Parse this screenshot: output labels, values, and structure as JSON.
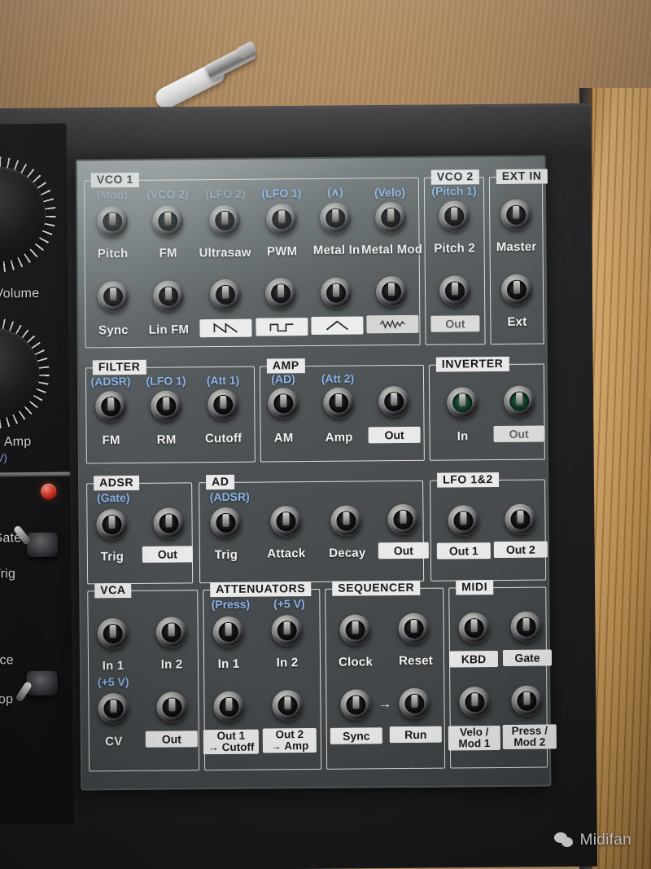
{
  "device": {
    "watermark_text": "Midifan",
    "watermark_icon": "wechat-icon"
  },
  "left_strip": {
    "controls": [
      {
        "label": "Volume",
        "type": "knob"
      },
      {
        "label": "- Amp",
        "sub": "V)",
        "type": "knob"
      },
      {
        "label": "Gate",
        "type": "toggle-top"
      },
      {
        "label": "Trig",
        "type": "toggle-bottom"
      },
      {
        "label": "nce",
        "type": "toggle-top"
      },
      {
        "label": "oop",
        "type": "toggle-bottom"
      }
    ]
  },
  "modules": [
    {
      "id": "vco1",
      "title": "VCO 1",
      "jacks": [
        {
          "label": "Pitch",
          "blue": "(Mod)",
          "blue_faded": true
        },
        {
          "label": "FM",
          "blue": "(VCO 2)",
          "blue_faded": true
        },
        {
          "label": "Ultrasaw",
          "blue": "(LFO 2)",
          "blue_faded": true
        },
        {
          "label": "PWM",
          "blue": "(LFO 1)",
          "blue_faded": false
        },
        {
          "label": "Metal In",
          "blue": "(∧)",
          "blue_faded": false
        },
        {
          "label": "Metal Mod",
          "blue": "(Velo)",
          "blue_faded": false
        },
        {
          "label": "Sync",
          "blue": ""
        },
        {
          "label": "Lin FM",
          "blue": ""
        },
        {
          "label": "saw-wave-icon",
          "blue": "",
          "chip": "wave",
          "wave": "saw"
        },
        {
          "label": "square-wave-icon",
          "blue": "",
          "chip": "wave",
          "wave": "square"
        },
        {
          "label": "triangle-wave-icon",
          "blue": "",
          "chip": "wave",
          "wave": "triangle"
        },
        {
          "label": "noise-wave-icon",
          "blue": "",
          "chip": "wave",
          "wave": "noise",
          "dim": true
        }
      ]
    },
    {
      "id": "vco2",
      "title": "VCO 2",
      "jacks": [
        {
          "label": "Pitch 2",
          "blue": "(Pitch 1)"
        },
        {
          "label": "Out",
          "blue": "",
          "chip": "dim"
        }
      ]
    },
    {
      "id": "extin",
      "title": "EXT IN",
      "jacks": [
        {
          "label": "Master",
          "blue": ""
        },
        {
          "label": "Ext",
          "blue": ""
        }
      ]
    },
    {
      "id": "filter",
      "title": "FILTER",
      "jacks": [
        {
          "label": "FM",
          "blue": "(ADSR)"
        },
        {
          "label": "RM",
          "blue": "(LFO 1)"
        },
        {
          "label": "Cutoff",
          "blue": "(Att 1)"
        }
      ]
    },
    {
      "id": "amp",
      "title": "AMP",
      "jacks": [
        {
          "label": "AM",
          "blue": "(AD)"
        },
        {
          "label": "Amp",
          "blue": "(Att 2)"
        },
        {
          "label": "Out",
          "blue": "",
          "chip": "plain"
        }
      ]
    },
    {
      "id": "inverter",
      "title": "INVERTER",
      "jacks": [
        {
          "label": "In",
          "blue": "",
          "green": true
        },
        {
          "label": "Out",
          "blue": "",
          "green": true,
          "chip": "dim"
        }
      ]
    },
    {
      "id": "adsr",
      "title": "ADSR",
      "jacks": [
        {
          "label": "Trig",
          "blue": "(Gate)"
        },
        {
          "label": "Out",
          "blue": "",
          "chip": "plain"
        }
      ]
    },
    {
      "id": "ad",
      "title": "AD",
      "jacks": [
        {
          "label": "Trig",
          "blue": "(ADSR)"
        },
        {
          "label": "Attack",
          "blue": ""
        },
        {
          "label": "Decay",
          "blue": ""
        },
        {
          "label": "Out",
          "blue": "",
          "chip": "plain"
        }
      ]
    },
    {
      "id": "lfo12",
      "title": "LFO 1&2",
      "jacks": [
        {
          "label": "Out 1",
          "blue": "",
          "chip": "plain"
        },
        {
          "label": "Out 2",
          "blue": "",
          "chip": "plain"
        }
      ]
    },
    {
      "id": "vca",
      "title": "VCA",
      "jacks": [
        {
          "label": "In 1",
          "blue": "",
          "blue_below": "(+5 V)"
        },
        {
          "label": "In 2",
          "blue": ""
        },
        {
          "label": "CV",
          "blue": ""
        },
        {
          "label": "Out",
          "blue": "",
          "chip": "plain"
        }
      ]
    },
    {
      "id": "attenuators",
      "title": "ATTENUATORS",
      "jacks": [
        {
          "label": "In 1",
          "blue": "(Press)"
        },
        {
          "label": "In 2",
          "blue": "(+5 V)"
        },
        {
          "label": "Out 1\n→ Cutoff",
          "blue": "",
          "chip": "two"
        },
        {
          "label": "Out 2\n→ Amp",
          "blue": "",
          "chip": "two"
        }
      ]
    },
    {
      "id": "sequencer",
      "title": "SEQUENCER",
      "jacks": [
        {
          "label": "Clock",
          "blue": ""
        },
        {
          "label": "Reset",
          "blue": ""
        },
        {
          "label": "Sync",
          "blue": "",
          "chip": "plain"
        },
        {
          "label": "Run",
          "blue": "",
          "chip": "plain"
        }
      ],
      "arrow": "→"
    },
    {
      "id": "midi",
      "title": "MIDI",
      "jacks": [
        {
          "label": "KBD",
          "blue": "",
          "chip": "plain"
        },
        {
          "label": "Gate",
          "blue": "",
          "chip": "plain"
        },
        {
          "label": "Velo /\nMod 1",
          "blue": "",
          "chip": "two"
        },
        {
          "label": "Press /\nMod 2",
          "blue": "",
          "chip": "two"
        }
      ]
    }
  ],
  "labels": {
    "vco1_title": "VCO 1",
    "vco2_title": "VCO 2",
    "extin_title": "EXT IN",
    "filter_title": "FILTER",
    "amp_title": "AMP",
    "inverter_title": "INVERTER",
    "adsr_title": "ADSR",
    "ad_title": "AD",
    "lfo_title": "LFO 1&2",
    "vca_title": "VCA",
    "att_title": "ATTENUATORS",
    "seq_title": "SEQUENCER",
    "midi_title": "MIDI"
  }
}
